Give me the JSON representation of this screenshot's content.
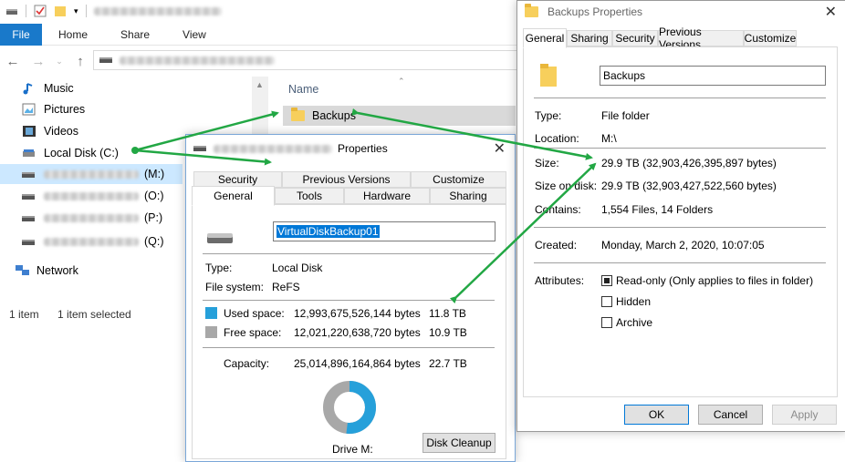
{
  "explorer": {
    "ribbon_tabs": [
      "File",
      "Home",
      "Share",
      "View"
    ],
    "column_name": "Name",
    "nav": [
      {
        "label": "Music",
        "icon": "music-icon"
      },
      {
        "label": "Pictures",
        "icon": "pictures-icon"
      },
      {
        "label": "Videos",
        "icon": "videos-icon"
      },
      {
        "label": "Local Disk (C:)",
        "icon": "drive-icon"
      },
      {
        "letter": "(M:)",
        "icon": "drive-icon"
      },
      {
        "letter": "(O:)",
        "icon": "drive-icon"
      },
      {
        "letter": "(P:)",
        "icon": "drive-icon"
      },
      {
        "letter": "(Q:)",
        "icon": "drive-icon"
      },
      {
        "label": "Network",
        "icon": "network-icon"
      }
    ],
    "file": "Backups",
    "status_count": "1 item",
    "status_selected": "1 item selected"
  },
  "drive_props": {
    "title_suffix": "Properties",
    "tabs_row1": [
      "Security",
      "Previous Versions",
      "Customize"
    ],
    "tabs_row2": [
      "General",
      "Tools",
      "Hardware",
      "Sharing"
    ],
    "name": "VirtualDiskBackup01",
    "type_label": "Type:",
    "type_value": "Local Disk",
    "fs_label": "File system:",
    "fs_value": "ReFS",
    "used_label": "Used space:",
    "used_bytes": "12,993,675,526,144 bytes",
    "used_tb": "11.8 TB",
    "free_label": "Free space:",
    "free_bytes": "12,021,220,638,720 bytes",
    "free_tb": "10.9 TB",
    "cap_label": "Capacity:",
    "cap_bytes": "25,014,896,164,864 bytes",
    "cap_tb": "22.7 TB",
    "drive_label": "Drive M:",
    "cleanup": "Disk Cleanup",
    "used_fraction": 0.519,
    "colors": {
      "used": "#26a0da",
      "free": "#a8a8a8"
    }
  },
  "folder_props": {
    "title": "Backups Properties",
    "tabs": [
      "General",
      "Sharing",
      "Security",
      "Previous Versions",
      "Customize"
    ],
    "name": "Backups",
    "rows": {
      "type_label": "Type:",
      "type_value": "File folder",
      "loc_label": "Location:",
      "loc_value": "M:\\",
      "size_label": "Size:",
      "size_value": "29.9 TB (32,903,426,395,897 bytes)",
      "sod_label": "Size on disk:",
      "sod_value": "29.9 TB (32,903,427,522,560 bytes)",
      "contains_label": "Contains:",
      "contains_value": "1,554 Files, 14 Folders",
      "created_label": "Created:",
      "created_value": "Monday, March 2, 2020, 10:07:05",
      "attr_label": "Attributes:",
      "readonly": "Read-only (Only applies to files in folder)",
      "hidden": "Hidden",
      "archive": "Archive"
    },
    "buttons": {
      "ok": "OK",
      "cancel": "Cancel",
      "apply": "Apply"
    }
  }
}
